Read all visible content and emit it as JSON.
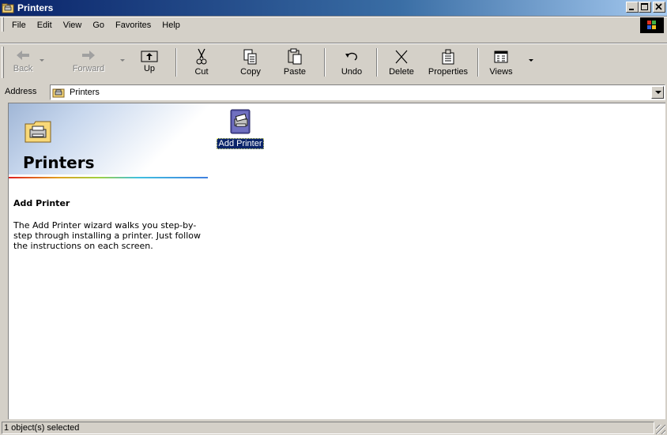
{
  "window": {
    "title": "Printers",
    "icons": {
      "app": "printers-folder-icon",
      "minimize": "minimize-icon",
      "maximize": "maximize-icon",
      "close": "close-icon"
    }
  },
  "menu": {
    "items": [
      "File",
      "Edit",
      "View",
      "Go",
      "Favorites",
      "Help"
    ]
  },
  "toolbar": {
    "buttons": [
      {
        "label": "Back",
        "icon": "back-arrow-icon",
        "enabled": false
      },
      {
        "label": "Forward",
        "icon": "forward-arrow-icon",
        "enabled": false
      },
      {
        "label": "Up",
        "icon": "up-folder-icon",
        "enabled": true
      },
      {
        "label": "Cut",
        "icon": "scissors-icon",
        "enabled": true
      },
      {
        "label": "Copy",
        "icon": "copy-icon",
        "enabled": true
      },
      {
        "label": "Paste",
        "icon": "paste-icon",
        "enabled": true
      },
      {
        "label": "Undo",
        "icon": "undo-icon",
        "enabled": true
      },
      {
        "label": "Delete",
        "icon": "delete-x-icon",
        "enabled": true
      },
      {
        "label": "Properties",
        "icon": "properties-icon",
        "enabled": true
      },
      {
        "label": "Views",
        "icon": "views-icon",
        "enabled": true
      }
    ]
  },
  "address": {
    "label": "Address",
    "value": "Printers"
  },
  "webview": {
    "title": "Printers",
    "subtitle": "Add Printer",
    "description": "The Add Printer wizard walks you step-by-step through installing a printer. Just follow the instructions on each screen."
  },
  "items": [
    {
      "label": "Add Printer",
      "icon": "add-printer-icon",
      "selected": true
    }
  ],
  "status": {
    "text": "1 object(s) selected"
  },
  "colors": {
    "titlebar_start": "#0a246a",
    "titlebar_end": "#a6caf0",
    "face": "#d4d0c8",
    "selection": "#0a246a"
  }
}
